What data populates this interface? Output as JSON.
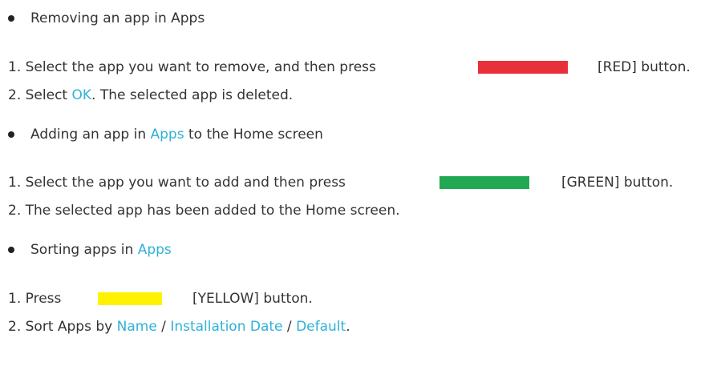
{
  "sections": [
    {
      "heading": [
        "Removing an app in Apps"
      ],
      "steps": [
        {
          "num": "1.",
          "pre": "Select the app you want to remove, and then press",
          "swatch": "#e8303a",
          "post": "[RED] button."
        },
        {
          "num": "2.",
          "parts": [
            "Select ",
            "OK",
            ". The selected app is deleted."
          ]
        }
      ]
    },
    {
      "heading": [
        "Adding an app in ",
        "Apps",
        " to the Home screen"
      ],
      "steps": [
        {
          "num": "1.",
          "pre": "Select the app you want to add and then press",
          "swatch": "#22a752",
          "post": "[GREEN] button."
        },
        {
          "num": "2.",
          "text": "The selected app has been added to the Home screen."
        }
      ]
    },
    {
      "heading": [
        "Sorting apps in ",
        "Apps"
      ],
      "steps": [
        {
          "num": "1.",
          "pre": "Press",
          "swatch": "#fff200",
          "post": "[YELLOW] button."
        },
        {
          "num": "2.",
          "parts": [
            "Sort Apps by ",
            "Name",
            " / ",
            "Installation Date",
            " / ",
            "Default",
            "."
          ]
        }
      ]
    }
  ],
  "colors": {
    "highlight": "#2fb1d6",
    "text": "#333333",
    "bullet": "#222222"
  }
}
